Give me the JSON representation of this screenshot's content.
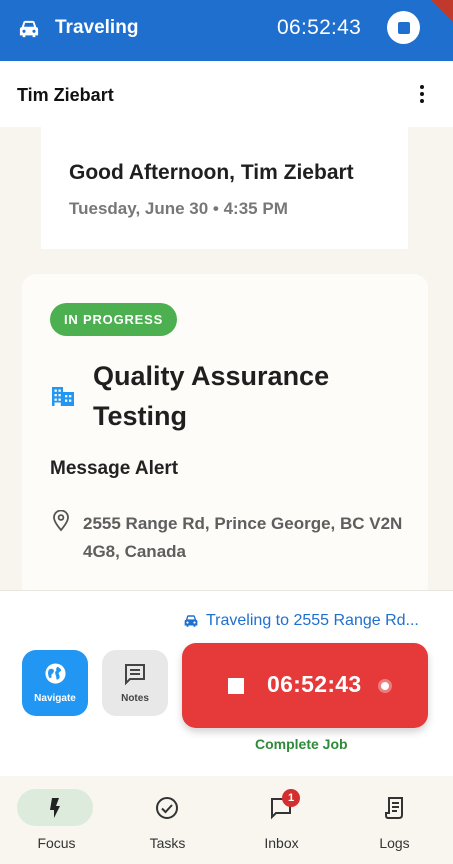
{
  "travel_bar": {
    "icon": "car-icon",
    "title": "Traveling",
    "timer": "06:52:43",
    "bg": "#1f6fcf"
  },
  "header": {
    "user_name": "Tim Ziebart",
    "menu_icon": "more-vert-icon"
  },
  "greeting": {
    "hello": "Good Afternoon, Tim Ziebart",
    "date": "Tuesday, June 30 • 4:35 PM"
  },
  "job": {
    "status": "IN PROGRESS",
    "status_color": "#4caf50",
    "icon": "building-icon",
    "title": "Quality Assurance Testing",
    "alert": "Message Alert",
    "address": "2555 Range Rd, Prince George, BC V2N 4G8, Canada"
  },
  "actions": {
    "traveling_text": "Traveling to 2555 Range Rd...",
    "navigate_label": "Navigate",
    "notes_label": "Notes",
    "job_timer": "06:52:43",
    "complete_label": "Complete Job",
    "timer_color": "#e5393a"
  },
  "bottom_nav": {
    "items": [
      {
        "label": "Focus",
        "icon": "bolt-icon",
        "active": true
      },
      {
        "label": "Tasks",
        "icon": "check-circle-icon",
        "active": false
      },
      {
        "label": "Inbox",
        "icon": "chat-icon",
        "active": false,
        "badge": "1"
      },
      {
        "label": "Logs",
        "icon": "log-icon",
        "active": false
      }
    ]
  }
}
